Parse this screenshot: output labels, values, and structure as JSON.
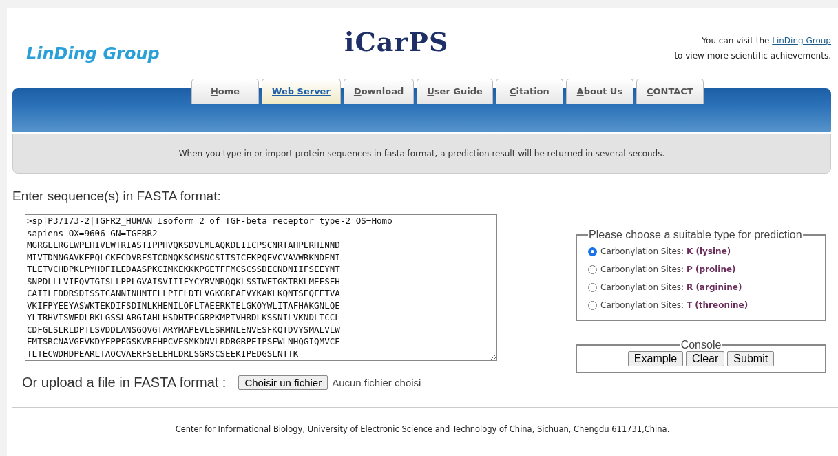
{
  "header": {
    "logo": "LinDing Group",
    "title": "iCarPS",
    "visit_text": "You can visit the",
    "visit_link": "LinDing Group",
    "visit_text2": "to view more scientific achievements."
  },
  "tabs": [
    {
      "label": "Home",
      "selected": false
    },
    {
      "label": "Web Server",
      "selected": true
    },
    {
      "label": "Download",
      "selected": false
    },
    {
      "label": "User Guide",
      "selected": false
    },
    {
      "label": "Citation",
      "selected": false
    },
    {
      "label": "About Us",
      "selected": false
    },
    {
      "label": "CONTACT",
      "selected": false
    }
  ],
  "notice": "When you type in or import protein sequences in fasta format, a prediction result will be returned in several seconds.",
  "sequence": {
    "label": "Enter sequence(s) in FASTA format:",
    "value": [
      ">sp|P37173-2|TGFR2_HUMAN Isoform 2 of TGF-beta receptor type-2 OS=Homo",
      "sapiens OX=9606 GN=TGFBR2",
      "MGRGLLRGLWPLHIVLWTRIASTIPPHVQKSDVEMEAQKDEIICPSCNRTAHPLRHINND",
      "MIVTDNNGAVKFPQLCKFCDVRFSTCDNQKSCMSNCSITSICEKPQEVCVAVWRKNDENI",
      "TLETVCHDPKLPYHDFILEDAASPKCIMKEKKKPGETFFMCSCSSDECNDNIIFSEEYNT",
      "SNPDLLLVIFQVTGISLLPPLGVAISVIIIFYCYRVNRQQKLSSTWETGKTRKLMEFSEH",
      "CAIILEDDRSDISSTCANNINHNTELLPIELDTLVGKGRFAEVYKAKLKQNTSEQFETVA",
      "VKIFPYEEYASWKTEKDIFSDINLKHENILQFLTAEERKTELGKQYWLITAFHAKGNLQE",
      "YLTRHVISWEDLRKLGSSLARGIAHLHSDHTPCGRPKMPIVHRDLKSSNILVKNDLTCCL",
      "CDFGLSLRLDPTLSVDDLANSGQVGTARYMAPEVLESRMNLENVESFKQTDVYSMALVLW",
      "EMTSRCNAVGEVKDYEPPFGSKVREHPCVESMKDNVLRDRGRPEIPSFWLNHQGIQMVCE",
      "TLTECWDHDPEARLTAQCVAERFSELEHLDRLSGRSCSEEKIPEDGSLNTTK"
    ]
  },
  "upload": {
    "label": "Or upload a file in FASTA format :",
    "button": "Choisir un fichier",
    "status": "Aucun fichier choisi"
  },
  "prediction": {
    "legend": "Please choose a suitable type for prediction",
    "options": [
      {
        "label": "Carbonylation Sites: **K (lysine)**",
        "selected": true
      },
      {
        "label": "Carbonylation Sites: **P (proline)**",
        "selected": false
      },
      {
        "label": "Carbonylation Sites: **R (arginine)**",
        "selected": false
      },
      {
        "label": "Carbonylation Sites: **T (threonine)**",
        "selected": false
      }
    ]
  },
  "console": {
    "legend": "Console",
    "buttons": [
      "Example",
      "Clear",
      "Submit"
    ]
  },
  "footer": "Center for Informational Biology, University of Electronic Science and Technology of China, Sichuan, Chengdu 611731,China."
}
